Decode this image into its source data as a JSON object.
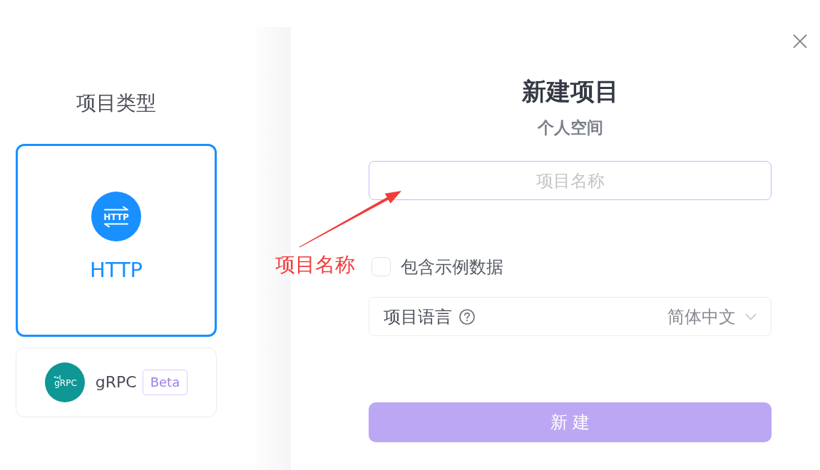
{
  "sidebar": {
    "title": "项目类型",
    "types": [
      {
        "kind": "http",
        "label": "HTTP",
        "icon_text": "HTTP",
        "selected": true
      },
      {
        "kind": "grpc",
        "label": "gRPC",
        "icon_text": "gRPC",
        "badge": "Beta",
        "selected": false
      }
    ]
  },
  "dialog": {
    "title": "新建项目",
    "subtitle": "个人空间",
    "name_field": {
      "placeholder": "项目名称"
    },
    "sample_data": {
      "label": "包含示例数据",
      "checked": false
    },
    "language": {
      "label": "项目语言",
      "value": "简体中文"
    },
    "submit": {
      "label": "新 建",
      "disabled": true
    }
  },
  "annotation": {
    "text": "项目名称"
  }
}
